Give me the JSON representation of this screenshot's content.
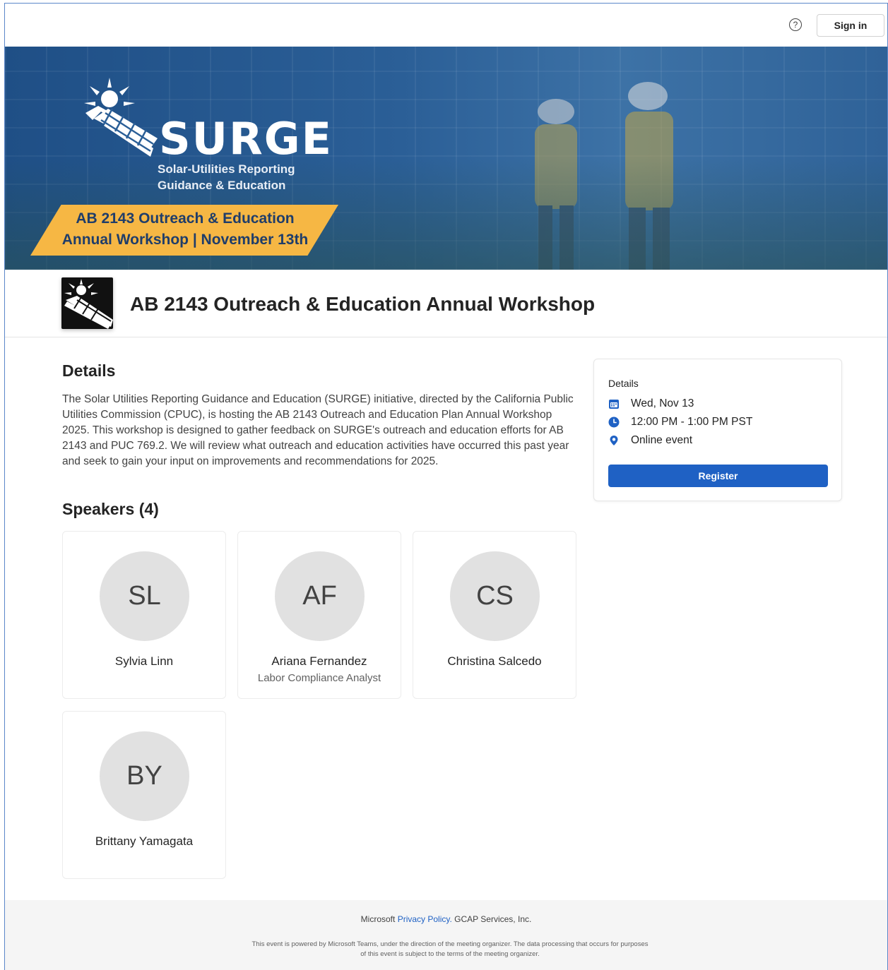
{
  "topbar": {
    "help_icon": "question-circle-icon",
    "help_glyph": "?",
    "signin_label": "Sign in"
  },
  "banner": {
    "brand": "SURGE",
    "brand_sub_line1": "Solar-Utilities Reporting",
    "brand_sub_line2": "Guidance & Education",
    "ribbon_line1": "AB 2143 Outreach & Education",
    "ribbon_line2": "Annual Workshop | November 13th",
    "ribbon_color": "#f6b744"
  },
  "event": {
    "title": "AB 2143 Outreach & Education Annual Workshop"
  },
  "details": {
    "section_title": "Details",
    "description": "The Solar Utilities Reporting Guidance and Education (SURGE) initiative, directed by the California Public Utilities Commission (CPUC), is hosting the AB 2143 Outreach and Education Plan Annual Workshop 2025. This workshop is designed to gather feedback on SURGE's outreach and education efforts for AB 2143 and PUC 769.2. We will review what outreach and education activities have occurred this past year and seek to gain your input on improvements and recommendations for 2025."
  },
  "side_card": {
    "heading": "Details",
    "date": "Wed, Nov 13",
    "time": "12:00 PM - 1:00 PM PST",
    "location": "Online event",
    "register_label": "Register",
    "accent": "#1f61c4"
  },
  "speakers": {
    "section_title": "Speakers (4)",
    "items": [
      {
        "initials": "SL",
        "name": "Sylvia Linn",
        "role": ""
      },
      {
        "initials": "AF",
        "name": "Ariana Fernandez",
        "role": "Labor Compliance Analyst"
      },
      {
        "initials": "CS",
        "name": "Christina Salcedo",
        "role": ""
      },
      {
        "initials": "BY",
        "name": "Brittany Yamagata",
        "role": ""
      }
    ]
  },
  "footer": {
    "prefix": "Microsoft",
    "privacy_link": "Privacy Policy.",
    "company": "GCAP Services, Inc.",
    "note_line1": "This event is powered by Microsoft Teams, under the direction of the meeting organizer. The data processing that occurs for purposes",
    "note_line2": "of this event is subject to the terms of the meeting organizer."
  }
}
